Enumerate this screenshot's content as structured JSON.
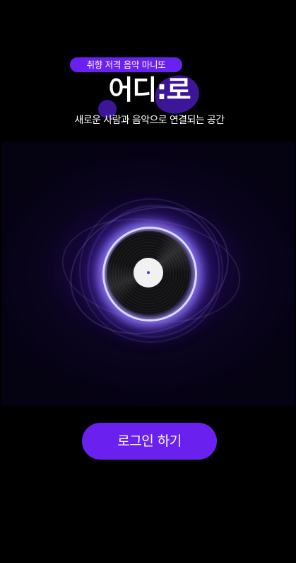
{
  "header": {
    "tagline": "취향 저격 음악 마니또",
    "app_title": "어디:로",
    "subtitle": "새로운 사람과 음악으로 연결되는 공간"
  },
  "login": {
    "button_label": "로그인 하기"
  },
  "colors": {
    "background": "#000000",
    "accent": "#6a21f0",
    "blob": "#3d1598",
    "text": "#ffffff"
  },
  "icons": {
    "hero": "vinyl-record-icon"
  }
}
